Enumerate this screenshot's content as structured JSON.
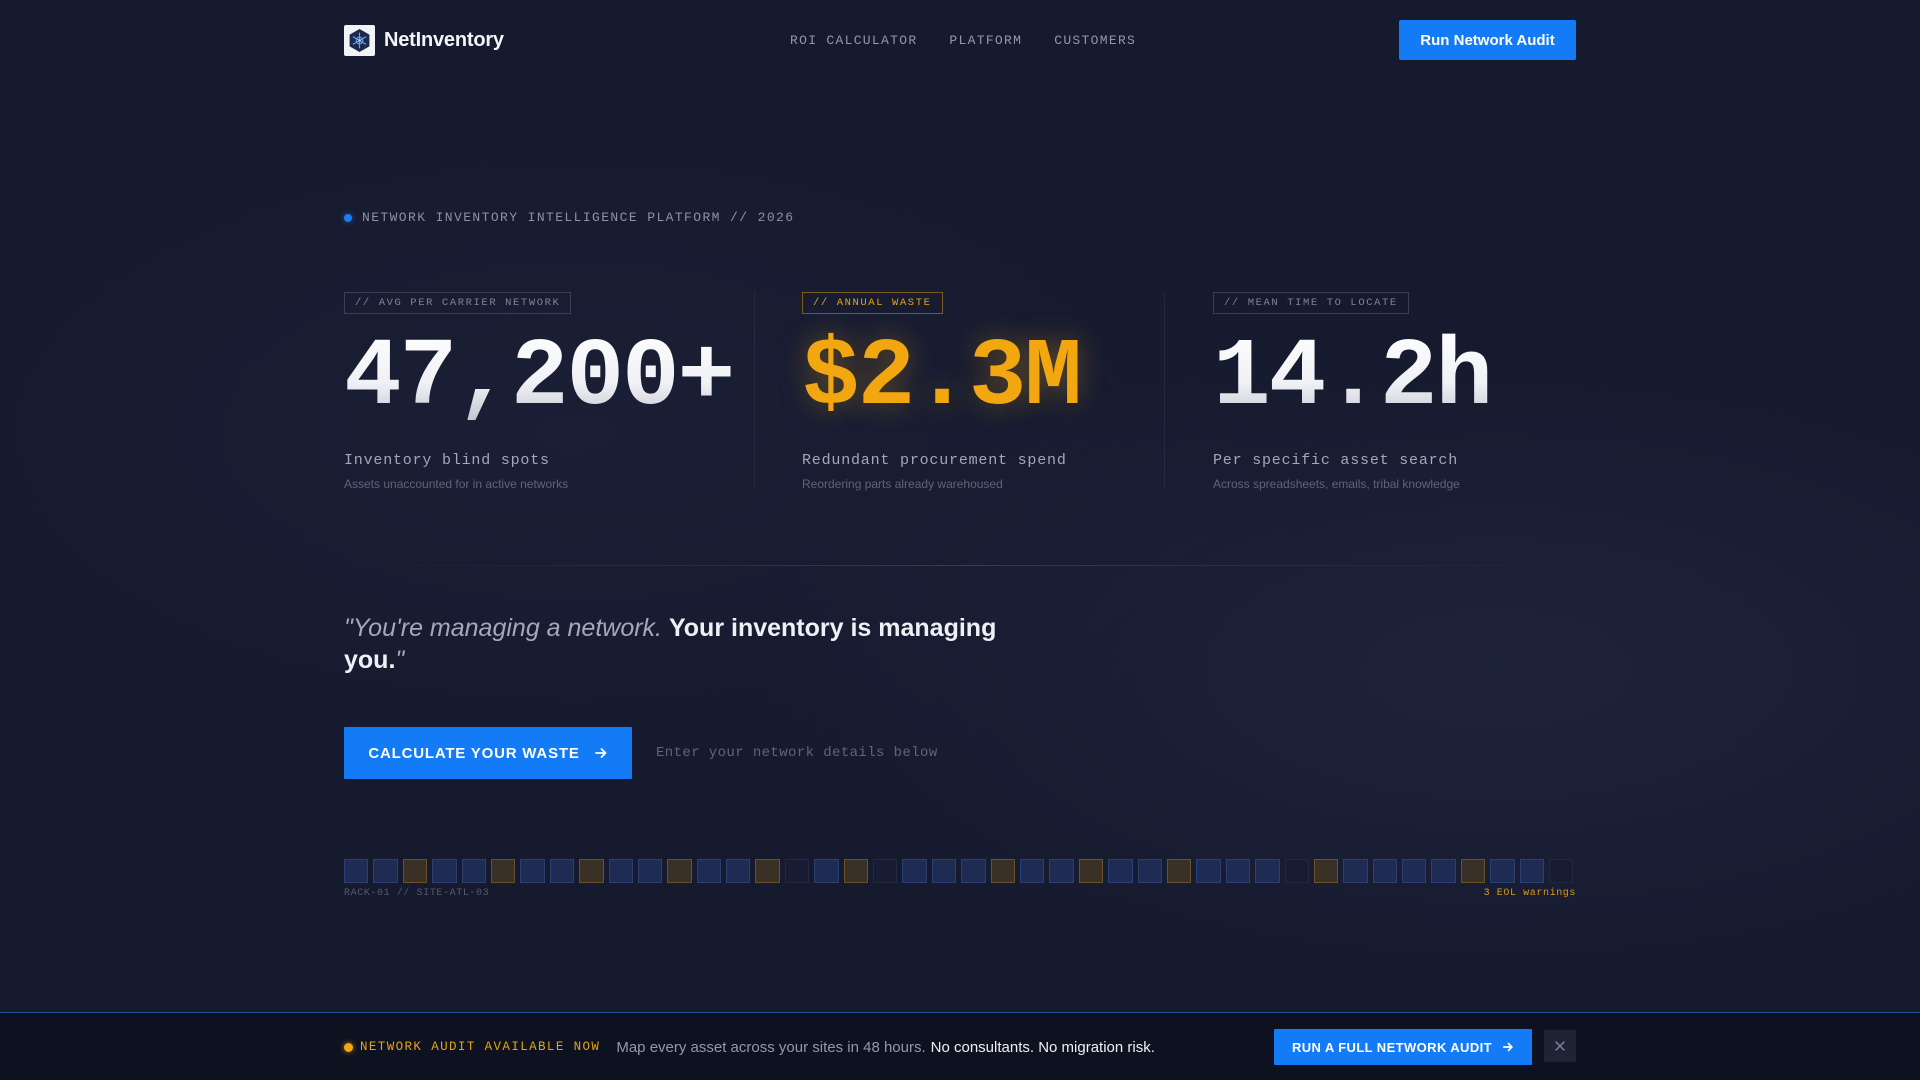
{
  "header": {
    "brand": "NetInventory",
    "nav": [
      "ROI CALCULATOR",
      "PLATFORM",
      "CUSTOMERS"
    ],
    "cta_label": "Run Network Audit"
  },
  "hero": {
    "eyebrow": "NETWORK INVENTORY INTELLIGENCE PLATFORM // 2026"
  },
  "stats": [
    {
      "tag": "// AVG PER CARRIER NETWORK",
      "value": "47,200+",
      "label": "Inventory blind spots",
      "sub": "Assets unaccounted for in active networks"
    },
    {
      "tag": "// ANNUAL WASTE",
      "value": "$2.3M",
      "label": "Redundant procurement spend",
      "sub": "Reordering parts already warehoused"
    },
    {
      "tag": "// MEAN TIME TO LOCATE",
      "value": "14.2h",
      "label": "Per specific asset search",
      "sub": "Across spreadsheets, emails, tribal knowledge"
    }
  ],
  "quote": {
    "soft": "\"You're managing a network.",
    "strong": "Your inventory is managing you.",
    "close": "\""
  },
  "cta": {
    "label": "CALCULATE YOUR WASTE",
    "hint": "Enter your network details below"
  },
  "rack": {
    "label": "RACK-01 // SITE-ATL-03",
    "warning": "3 EOL warnings",
    "cells": [
      "blue",
      "blue",
      "amber",
      "blue",
      "blue",
      "amber",
      "blue",
      "blue",
      "amber",
      "blue",
      "blue",
      "amber",
      "blue",
      "blue",
      "amber",
      "empty",
      "blue",
      "amber",
      "empty",
      "blue",
      "blue",
      "blue",
      "amber",
      "blue",
      "blue",
      "amber",
      "blue",
      "blue",
      "amber",
      "blue",
      "blue",
      "blue",
      "empty",
      "amber",
      "blue",
      "blue",
      "blue",
      "blue",
      "amber",
      "blue",
      "blue",
      "empty"
    ]
  },
  "bottom_bar": {
    "tag": "NETWORK AUDIT AVAILABLE NOW",
    "message": "Map every asset across your sites in 48 hours.",
    "message_strong": "No consultants. No migration risk.",
    "cta_label": "RUN A FULL NETWORK AUDIT",
    "close_icon": "close-icon"
  },
  "colors": {
    "accent_blue": "#137bf5",
    "accent_amber": "#f2a60f",
    "background": "#161a2e"
  }
}
